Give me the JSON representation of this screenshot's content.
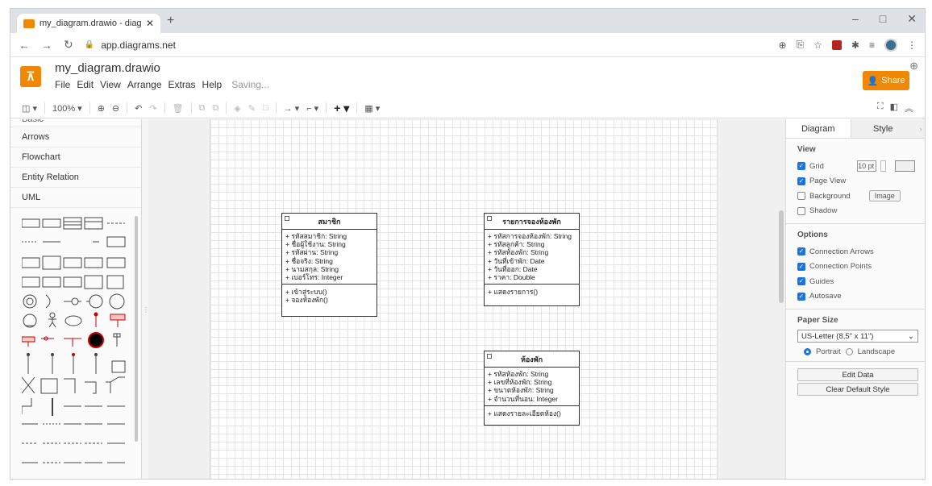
{
  "browser": {
    "tab_title": "my_diagram.drawio - diagrams.n",
    "url": "app.diagrams.net"
  },
  "app": {
    "doc_name": "my_diagram.drawio",
    "menu": [
      "File",
      "Edit",
      "View",
      "Arrange",
      "Extras",
      "Help"
    ],
    "status": "Saving...",
    "share_label": "Share",
    "brand_color": "#f08705"
  },
  "toolbar": {
    "zoom": "100%"
  },
  "sidebar": {
    "partial_label": "Basic",
    "categories": [
      "Arrows",
      "Flowchart",
      "Entity Relation",
      "UML"
    ]
  },
  "diagram": {
    "classes": [
      {
        "name": "สมาชิก",
        "attributes": [
          "+ รหัสสมาชิก: String",
          "+ ชื่อผู้ใช้งาน: String",
          "+ รหัสผ่าน: String",
          "+ ชื่อจริง: String",
          "+ นามสกุล: String",
          "+ เบอร์โทร: Integer"
        ],
        "operations": [
          "+ เข้าสู่ระบบ()",
          "+ จองห้องพัก()"
        ]
      },
      {
        "name": "รายการจองห้องพัก",
        "attributes": [
          "+ รหัสการจองห้องพัก: String",
          "+ รหัสลูกค้า: String",
          "+ รหัสห้องพัก: String",
          "+ วันที่เข้าพัก: Date",
          "+ วันที่ออก: Date",
          "+ ราคา: Double"
        ],
        "operations": [
          "+ แสดงรายการ()"
        ]
      },
      {
        "name": "ห้องพัก",
        "attributes": [
          "+ รหัสห้องพัก: String",
          "+ เลขที่ห้องพัก: String",
          "+ ขนาดห้องพัก: String",
          "+ จำนวนที่นอน: Integer"
        ],
        "operations": [
          "+ แสดงรายละเอียดห้อง()"
        ]
      }
    ]
  },
  "format_panel": {
    "tabs": [
      "Diagram",
      "Style"
    ],
    "view": {
      "heading": "View",
      "grid_label": "Grid",
      "grid_size": "10 pt",
      "page_view_label": "Page View",
      "background_label": "Background",
      "image_button": "Image",
      "shadow_label": "Shadow"
    },
    "options": {
      "heading": "Options",
      "items": [
        "Connection Arrows",
        "Connection Points",
        "Guides",
        "Autosave"
      ]
    },
    "paper": {
      "heading": "Paper Size",
      "selected": "US-Letter (8,5\" x 11\")",
      "portrait": "Portrait",
      "landscape": "Landscape"
    },
    "buttons": [
      "Edit Data",
      "Clear Default Style"
    ]
  }
}
